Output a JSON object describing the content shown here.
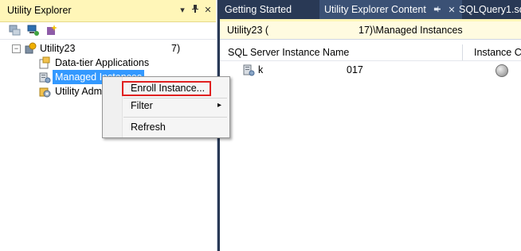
{
  "left_panel": {
    "title": "Utility Explorer",
    "pin_glyph": "▾",
    "autohide_glyph": "ᵸ",
    "close_glyph": "✕",
    "toolbar_icons": [
      "connect-icon",
      "refresh-icon",
      "wizard-icon"
    ],
    "tree": {
      "root": {
        "label": "Utility23",
        "suffix": ")7)",
        "expander": "−"
      },
      "children": [
        {
          "label": "Data-tier Applications"
        },
        {
          "label": "Managed Instances"
        },
        {
          "label": "Utility Adm"
        }
      ]
    }
  },
  "tabs": [
    {
      "label": "Getting Started"
    },
    {
      "label": "Utility Explorer Content",
      "pin": "ᵸ",
      "close": "✕"
    },
    {
      "label": "SQLQuery1.sq"
    }
  ],
  "content": {
    "path_left": "Utility23 (",
    "path_right": "17)\\Managed Instances",
    "columns": [
      "SQL Server Instance Name",
      "Instance CF"
    ],
    "row": {
      "name_left": "k",
      "name_right": "017"
    }
  },
  "context_menu": {
    "items": [
      {
        "label": "Enroll Instance..."
      },
      {
        "label": "Filter",
        "submenu_arrow": "▸"
      },
      {
        "label": "Refresh"
      }
    ]
  },
  "colors": {
    "background": "#293955",
    "panel_title": "#fff6b8",
    "selection": "#3399ff",
    "highlight_box": "#e02020"
  }
}
